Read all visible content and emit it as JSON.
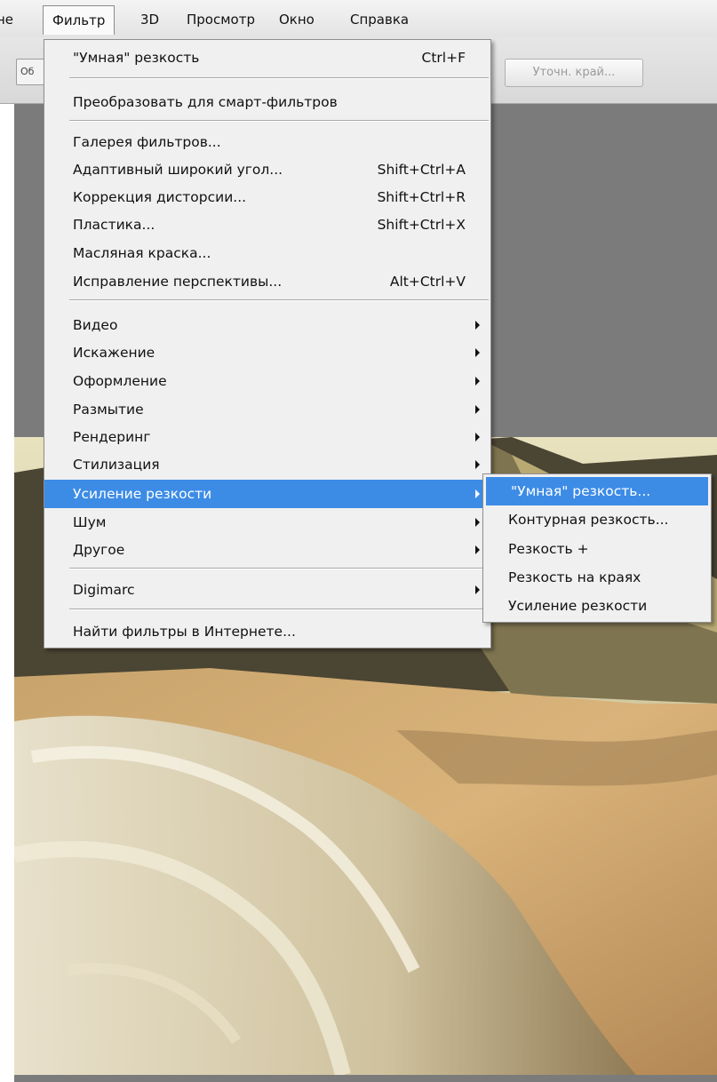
{
  "menubar": {
    "items": [
      {
        "label": "не"
      },
      {
        "label": "Фильтр"
      },
      {
        "label": "3D"
      },
      {
        "label": "Просмотр"
      },
      {
        "label": "Окно"
      },
      {
        "label": "Справка"
      }
    ]
  },
  "options": {
    "stub_label": "Об",
    "refine_label": "Уточн. край..."
  },
  "filter_menu": {
    "items": [
      {
        "label": "\"Умная\" резкость",
        "shortcut": "Ctrl+F"
      },
      {
        "label": "Преобразовать для смарт-фильтров"
      },
      {
        "label": "Галерея фильтров..."
      },
      {
        "label": "Адаптивный широкий угол...",
        "shortcut": "Shift+Ctrl+A"
      },
      {
        "label": "Коррекция дисторсии...",
        "shortcut": "Shift+Ctrl+R"
      },
      {
        "label": "Пластика...",
        "shortcut": "Shift+Ctrl+X"
      },
      {
        "label": "Масляная краска..."
      },
      {
        "label": "Исправление перспективы...",
        "shortcut": "Alt+Ctrl+V"
      },
      {
        "label": "Видео"
      },
      {
        "label": "Искажение"
      },
      {
        "label": "Оформление"
      },
      {
        "label": "Размытие"
      },
      {
        "label": "Рендеринг"
      },
      {
        "label": "Стилизация"
      },
      {
        "label": "Усиление резкости"
      },
      {
        "label": "Шум"
      },
      {
        "label": "Другое"
      },
      {
        "label": "Digimarc"
      },
      {
        "label": "Найти фильтры в Интернете..."
      }
    ]
  },
  "sharpen_submenu": {
    "items": [
      {
        "label": "\"Умная\" резкость..."
      },
      {
        "label": "Контурная резкость..."
      },
      {
        "label": "Резкость +"
      },
      {
        "label": "Резкость на краях"
      },
      {
        "label": "Усиление резкости"
      }
    ]
  },
  "colors": {
    "highlight": "#3c8ce6",
    "menu_bg": "#f0f0f0",
    "workspace": "#7b7b7b"
  }
}
